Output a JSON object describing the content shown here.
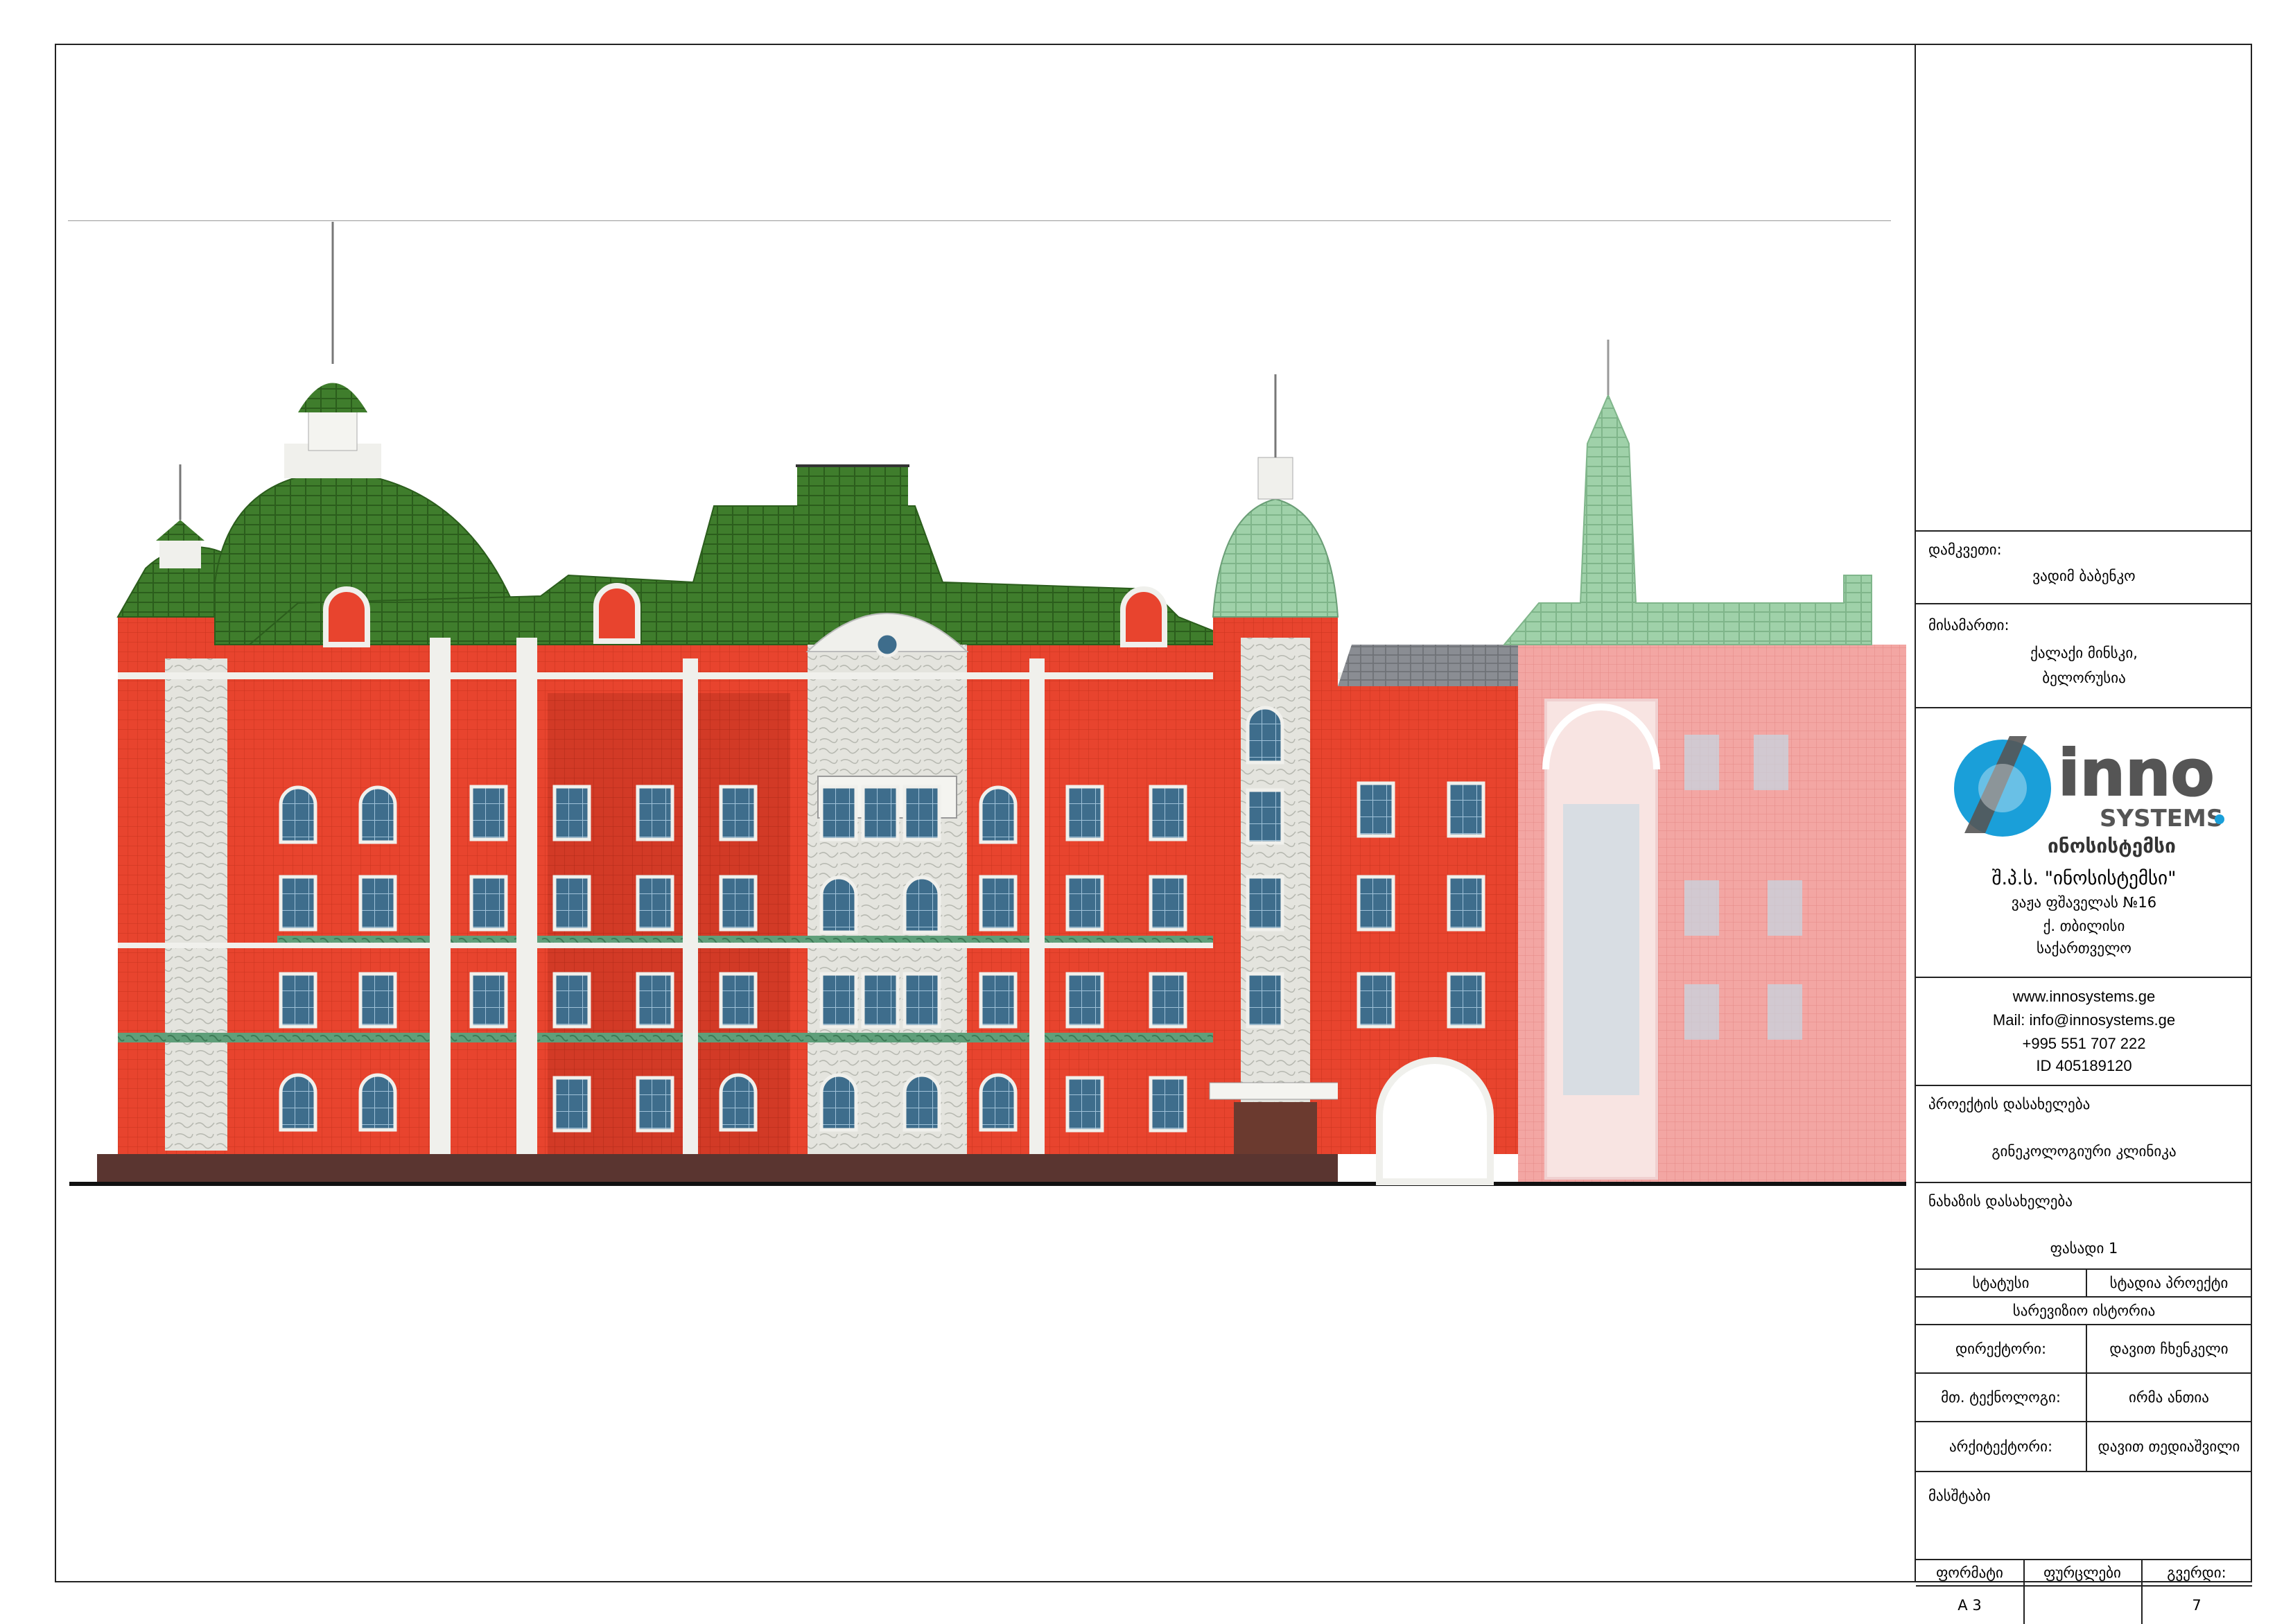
{
  "stamp": {
    "customer_label": "დამკვეთი:",
    "customer_value": "ვადიმ ბაბენკო",
    "address_label": "მისამართი:",
    "address_line1": "ქალაქი მინსკი,",
    "address_line2": "ბელორუსია",
    "logo": {
      "brand_main": "inno",
      "brand_sub": "SYSTEMS",
      "brand_geo": "ინოსისტემსი",
      "accent_color": "#1a9fd9",
      "text_color": "#555555"
    },
    "company_name": "შ.პ.ს. \"ინოსისტემსი\"",
    "company_street": "ვაჟა ფშაველას №16",
    "company_city": "ქ. თბილისი",
    "company_country": "საქართველო",
    "website": "www.innosystems.ge",
    "mail": "Mail: info@innosystems.ge",
    "phone": "+995 551 707 222",
    "id": "ID 405189120",
    "project_label": "პროექტის დასახელება",
    "project_value": "გინეკოლოგიური კლინიკა",
    "drawing_label": "ნახაზის დასახელება",
    "drawing_value": "ფასადი 1",
    "status_label": "სტატუსი",
    "status_value": "სტადია პროექტი",
    "revision_label": "სარევიზიო ისტორია",
    "director_label": "დირექტორი:",
    "director_value": "დავით ჩხენკელი",
    "technologist_label": "მთ. ტექნოლოგი:",
    "technologist_value": "ირმა ანთია",
    "architect_label": "არქიტექტორი:",
    "architect_value": "დავით თედიაშვილი",
    "scale_label": "მასშტაბი",
    "format_label": "ფორმატი",
    "sheets_label": "ფურცლები",
    "page_label": "გვერდი:",
    "format_value": "A 3",
    "sheets_value": "",
    "page_value": "7"
  },
  "colors": {
    "facade_red": "#e8442e",
    "roof_green": "#3f7d2c",
    "roof_green_light": "#8fc49a",
    "facade_pink": "#f2a0a0",
    "stone_white": "#e9e9e4",
    "window_blue": "#3e6d8c",
    "plinth": "#5a3530"
  }
}
